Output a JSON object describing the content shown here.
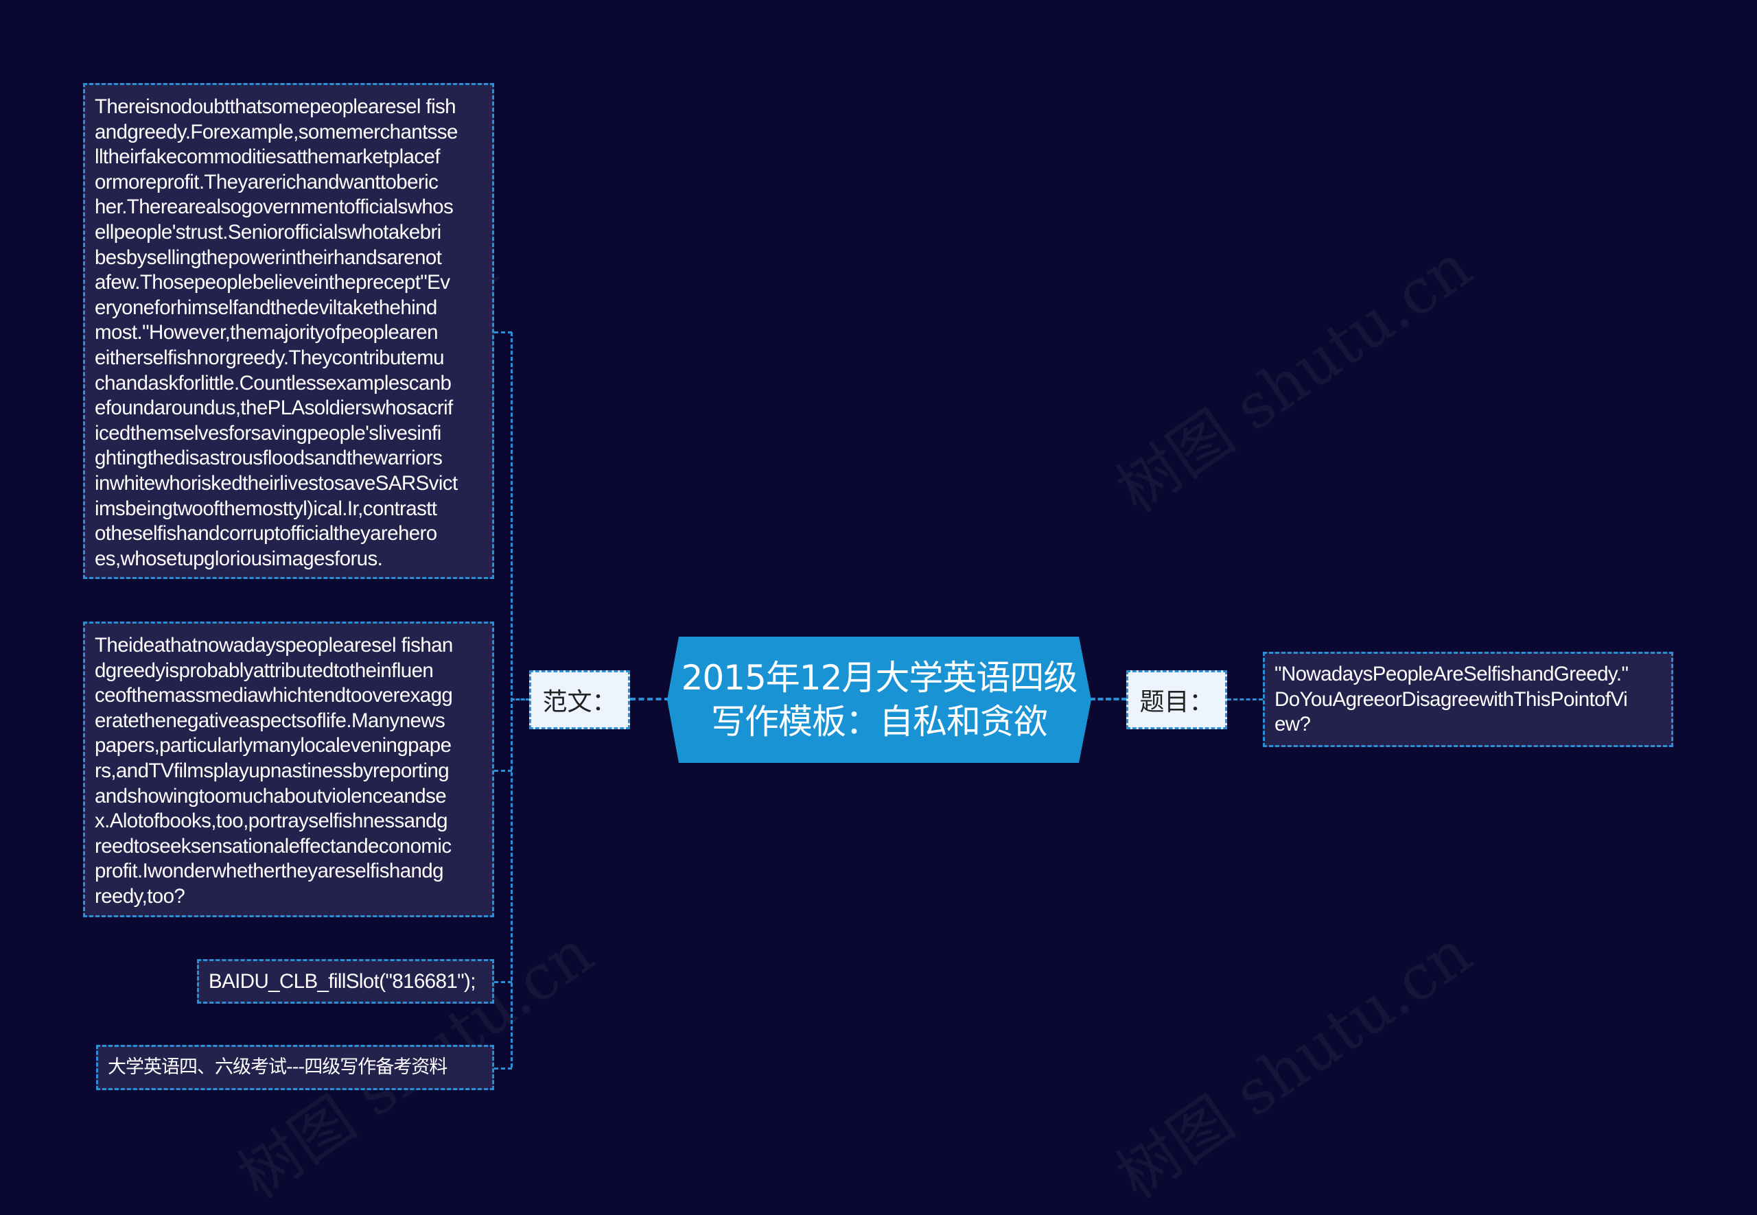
{
  "center": {
    "title_lines": [
      "2015年12月大学英语四级",
      "写作模板：自私和贪欲"
    ],
    "color": "#1a93d4"
  },
  "left_branch": {
    "label": "范文：",
    "paragraph1_lines": [
      "Thereisnodoubtthatsomepeoplearesel fish",
      "andgreedy.Forexample,somemerchantsse",
      "lltheirfakecommoditiesatthemarketplacef",
      "ormoreprofit.Theyarerichandwanttoberic",
      "her.Therearealsogovernmentofficialswhos",
      "ellpeople'strust.Seniorofficialswhotakebri",
      "besbysellingthepowerintheirhandsarenot",
      "afew.Thosepeoplebelieveintheprecept\"Ev",
      "eryoneforhimselfandthedeviltakethehind",
      "most.\"However,themajorityofpeoplearen",
      "eitherselfishnorgreedy.Theycontributemu",
      "chandaskforlittle.Countlessexamplescanb",
      "efoundaroundus,thePLAsoldierswhosacrif",
      "icedthemselvesforsavingpeople'slivesinfi",
      "ghtingthedisastrousfloodsandthewarriors",
      "inwhitewhoriskedtheirlivestosaveSARSvict",
      "imsbeingtwoofthemosttyl)ical.Ir,contrastt",
      "otheselfishandcorruptofficialtheyarehero",
      "es,whosetupgloriousimagesforus."
    ],
    "paragraph2_lines": [
      "Theideathatnowadayspeoplearesel fishan",
      "dgreedyisprobablyattributedtotheinfluen",
      "ceofthemassmediawhichtendtooverexagg",
      "eratethenegativeaspectsoflife.Manynews",
      "papers,particularlymanylocaleveningpape",
      "rs,andTVfilmsplayupnastinessbyreporting",
      "andshowingtoomuchaboutviolenceandse",
      "x.Alotofbooks,too,portrayselfishnessandg",
      "reedtoseeksensationaleffectandeconomic",
      "profit.Iwonderwhethertheyareselfishandg",
      "reedy,too?"
    ],
    "code_snippet": "BAIDU_CLB_fillSlot(\"816681\");",
    "resource_title": "大学英语四、六级考试---四级写作备考资料"
  },
  "right_branch": {
    "label": "题目：",
    "question_lines": [
      "\"NowadaysPeopleAreSelfishandGreedy.\"",
      "DoYouAgreeorDisagreewithThisPointofVi",
      "ew?"
    ]
  },
  "watermark": "树图 shutu.cn",
  "colors": {
    "background": "#0a0830",
    "node_fill": "#24224c",
    "border": "#2b8fd8",
    "label_fill": "#eef4fd"
  }
}
